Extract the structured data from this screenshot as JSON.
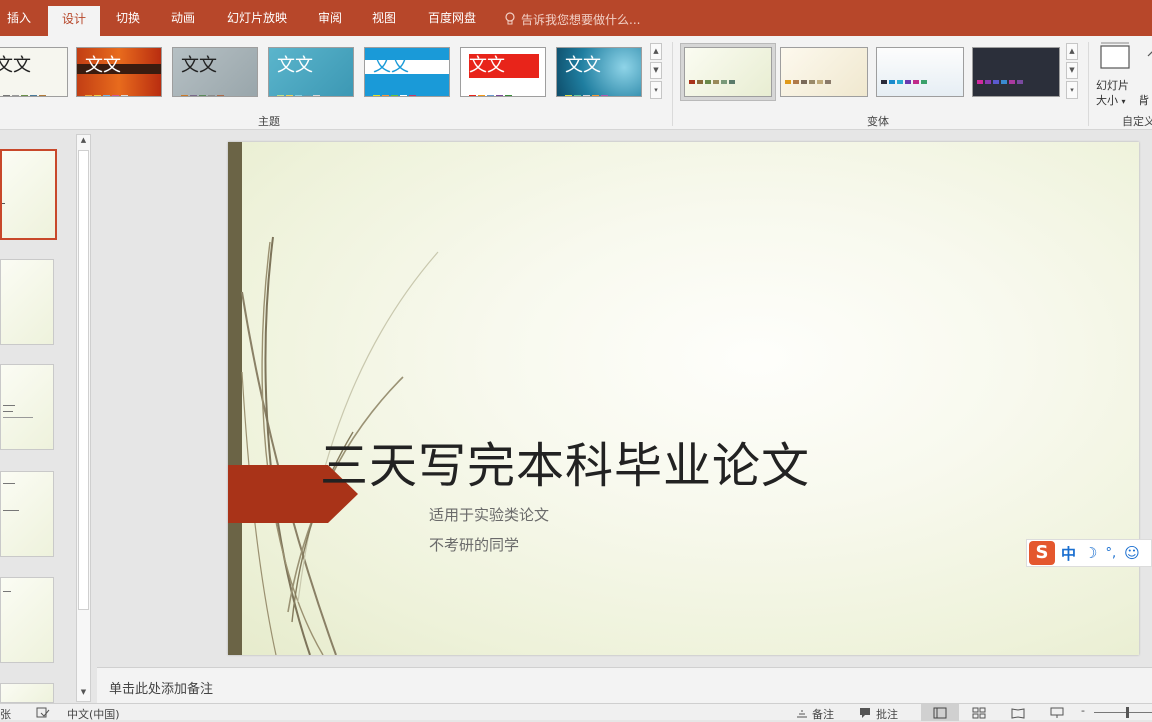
{
  "tabs": [
    {
      "label": "插入",
      "active": false
    },
    {
      "label": "设计",
      "active": true
    },
    {
      "label": "切换",
      "active": false
    },
    {
      "label": "动画",
      "active": false
    },
    {
      "label": "幻灯片放映",
      "active": false
    },
    {
      "label": "审阅",
      "active": false
    },
    {
      "label": "视图",
      "active": false
    },
    {
      "label": "百度网盘",
      "active": false
    }
  ],
  "tell_me": {
    "placeholder": "告诉我您想要做什么...",
    "icon": "lightbulb-icon"
  },
  "ribbon": {
    "themes_group_label": "主题",
    "variants_group_label": "变体",
    "theme_sample_text": "文文",
    "slide_size_label_1": "幻灯片",
    "slide_size_label_2": "大小",
    "bg_label": "背",
    "custom_group_label": "自定义"
  },
  "slide": {
    "title": "三天写完本科毕业论文",
    "subtitle_line1": "适用于实验类论文",
    "subtitle_line2": "不考研的同学"
  },
  "ime": {
    "logo": "S",
    "lang": "中",
    "moon": "☽",
    "punct": "°,",
    "emoji": "☺"
  },
  "notes_placeholder": "单击此处添加备注",
  "status": {
    "slide_count_fragment": "张",
    "language": "中文(中国)",
    "notes_btn": "备注",
    "comments_btn": "批注"
  },
  "colors": {
    "accent": "#b7472a",
    "slide_arrow": "#a93318",
    "slide_bar": "#6b6446"
  }
}
